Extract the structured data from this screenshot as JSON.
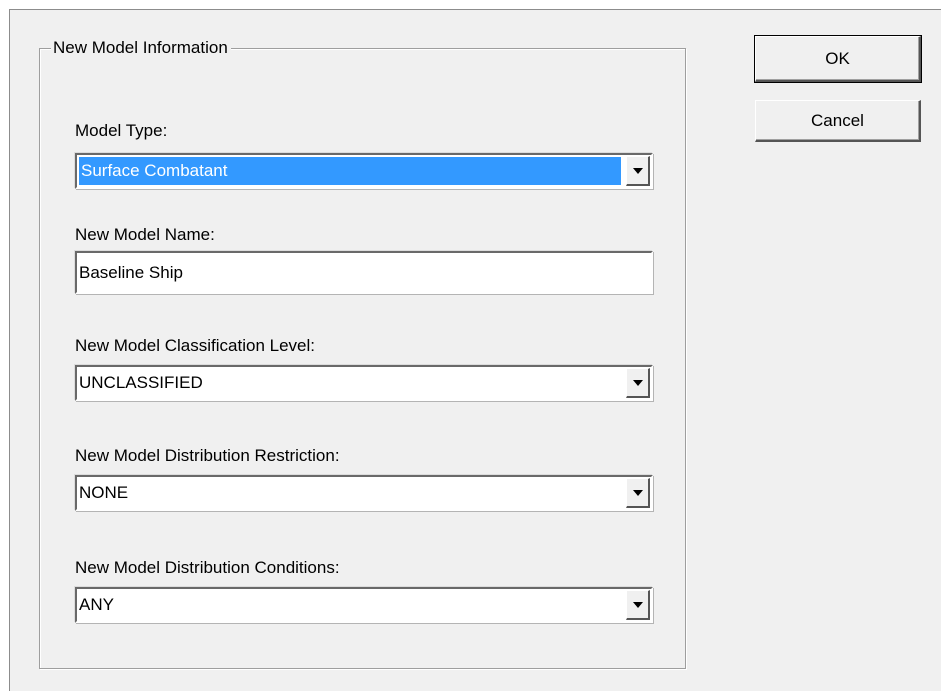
{
  "dialog": {
    "group_title": "New Model Information",
    "model_type": {
      "label": "Model Type:",
      "value": "Surface Combatant"
    },
    "model_name": {
      "label": "New Model Name:",
      "value": "Baseline Ship"
    },
    "classification_level": {
      "label": "New Model Classification Level:",
      "value": "UNCLASSIFIED"
    },
    "distribution_restriction": {
      "label": "New Model Distribution Restriction:",
      "value": "NONE"
    },
    "distribution_conditions": {
      "label": "New Model Distribution Conditions:",
      "value": "ANY"
    },
    "buttons": {
      "ok": "OK",
      "cancel": "Cancel"
    }
  },
  "colors": {
    "dialog_background": "#f0f0f0",
    "selection_highlight": "#3399ff",
    "selection_text": "#ffffff"
  },
  "icons": {
    "dropdown": "chevron-down-icon"
  }
}
